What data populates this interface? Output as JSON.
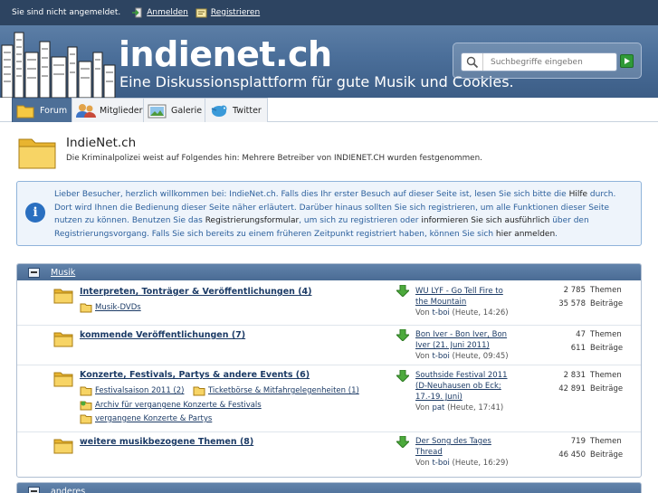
{
  "topbar": {
    "status": "Sie sind nicht angemeldet.",
    "login": "Anmelden",
    "register": "Registrieren"
  },
  "header": {
    "title": "indienet.ch",
    "subtitle": "Eine Diskussionsplattform für gute Musik und Cookies."
  },
  "search": {
    "placeholder": "Suchbegriffe eingeben"
  },
  "tabs": [
    {
      "label": "Forum",
      "icon": "folder-icon"
    },
    {
      "label": "Mitglieder",
      "icon": "members-icon"
    },
    {
      "label": "Galerie",
      "icon": "gallery-icon"
    },
    {
      "label": "Twitter",
      "icon": "twitter-bird-icon"
    }
  ],
  "intro": {
    "title": "IndieNet.ch",
    "description": "Die Kriminalpolizei weist auf Folgendes hin: Mehrere Betreiber von INDIENET.CH wurden festgenommen."
  },
  "info": {
    "p1": "Lieber Besucher, herzlich willkommen bei: IndieNet.ch. Falls dies Ihr erster Besuch auf dieser Seite ist, lesen Sie sich bitte die ",
    "link_help": "Hilfe",
    "p2": " durch. Dort wird Ihnen die Bedienung dieser Seite näher erläutert. Darüber hinaus sollten Sie sich registrieren, um alle Funktionen dieser Seite nutzen zu können. Benutzen Sie das ",
    "link_form": "Registrierungsformular",
    "p3": ", um sich zu registrieren oder ",
    "link_inform": "informieren Sie sich ausführlich",
    "p4": " über den Registrierungsvorgang. Falls Sie sich bereits zu einem früheren Zeitpunkt registriert haben, können Sie sich ",
    "link_login": "hier anmelden",
    "p5": "."
  },
  "category": {
    "title": "Musik",
    "boards": [
      {
        "name": "Interpreten, Tonträger & Veröffentlichungen (4)",
        "subs": [
          "Musik-DVDs"
        ],
        "last_title": "WU LYF - Go Tell Fire to the Mountain",
        "last_by_prefix": "Von",
        "last_user": "t-boi",
        "last_time": "(Heute, 14:26)",
        "threads": "2 785",
        "threads_label": "Themen",
        "posts": "35 578",
        "posts_label": "Beiträge"
      },
      {
        "name": "kommende Veröffentlichungen (7)",
        "subs": [],
        "last_title": "Bon Iver - Bon Iver, Bon Iver (21. Juni 2011)",
        "last_by_prefix": "Von",
        "last_user": "t-boi",
        "last_time": "(Heute, 09:45)",
        "threads": "47",
        "threads_label": "Themen",
        "posts": "611",
        "posts_label": "Beiträge"
      },
      {
        "name": "Konzerte, Festivals, Partys & andere Events (6)",
        "subs": [
          "Festivalsaison 2011 (2)",
          "Ticketbörse & Mitfahrgelegenheiten (1)",
          "Archiv für vergangene Konzerte & Festivals",
          "vergangene Konzerte & Partys"
        ],
        "last_title": "Southside Festival 2011 (D-Neuhausen ob Eck; 17.-19. Juni)",
        "last_by_prefix": "Von",
        "last_user": "pat",
        "last_time": "(Heute, 17:41)",
        "threads": "2 831",
        "threads_label": "Themen",
        "posts": "42 891",
        "posts_label": "Beiträge"
      },
      {
        "name": "weitere musikbezogene Themen (8)",
        "subs": [],
        "last_title": "Der Song des Tages Thread",
        "last_by_prefix": "Von",
        "last_user": "t-boi",
        "last_time": "(Heute, 16:29)",
        "threads": "719",
        "threads_label": "Themen",
        "posts": "46 450",
        "posts_label": "Beiträge"
      }
    ]
  },
  "category2": {
    "title": "anderes"
  },
  "colors": {
    "accent": "#4a6e99",
    "topbar": "#2d4461",
    "info_text": "#2b5f9c"
  }
}
